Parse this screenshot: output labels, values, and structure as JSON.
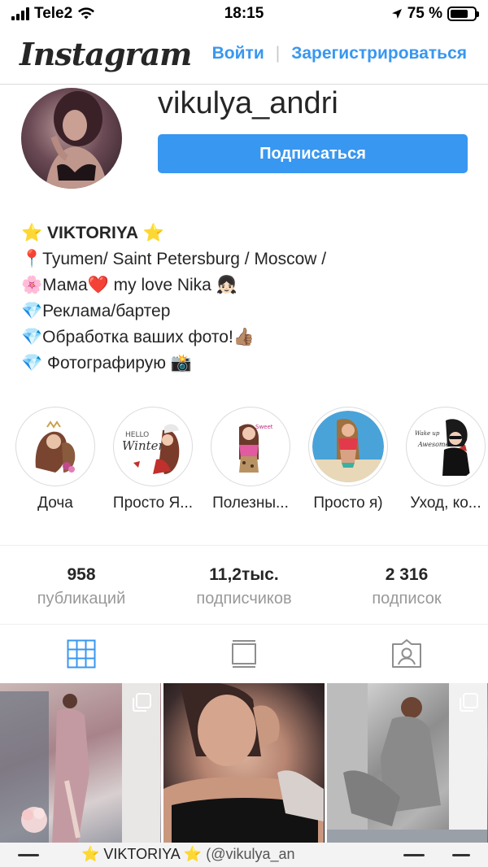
{
  "status_bar": {
    "carrier": "Tele2",
    "time": "18:15",
    "battery": "75 %",
    "battery_level": 0.75
  },
  "header": {
    "logo": "Instagram",
    "login_label": "Войти",
    "signup_label": "Зарегистрироваться"
  },
  "profile": {
    "username": "vikulya_andri",
    "follow_label": "Подписаться"
  },
  "bio": {
    "line1_star_left": "⭐",
    "line1_name": "VIKTORIYA",
    "line1_star_right": "⭐",
    "line2": "📍Tyumen/ Saint Petersburg / Moscow /",
    "line3": "🌸Мама❤️ my love Nika 👧🏻",
    "line4": "💎Реклама/бартер",
    "line5": "💎Обработка ваших фото!👍🏽",
    "line6": "💎 Фотографирую 📸"
  },
  "highlights": [
    {
      "label": "Доча"
    },
    {
      "label": "Просто Я..."
    },
    {
      "label": "Полезны..."
    },
    {
      "label": "Просто я)"
    },
    {
      "label": "Уход, ко..."
    }
  ],
  "stats": {
    "posts_value": "958",
    "posts_label": "публикаций",
    "followers_value": "11,2тыс.",
    "followers_label": "подписчиков",
    "following_value": "2 316",
    "following_label": "подписок"
  },
  "tabs": {
    "grid_icon": "grid-icon",
    "feed_icon": "feed-icon",
    "tagged_icon": "tagged-icon",
    "active_color": "#3897f0"
  },
  "bottom_bar": {
    "name": "⭐ VIKTORIYA ⭐",
    "handle": "(@vikulya_an"
  },
  "colors": {
    "accent": "#3897f0",
    "muted": "#999999",
    "border": "#dbdbdb"
  }
}
